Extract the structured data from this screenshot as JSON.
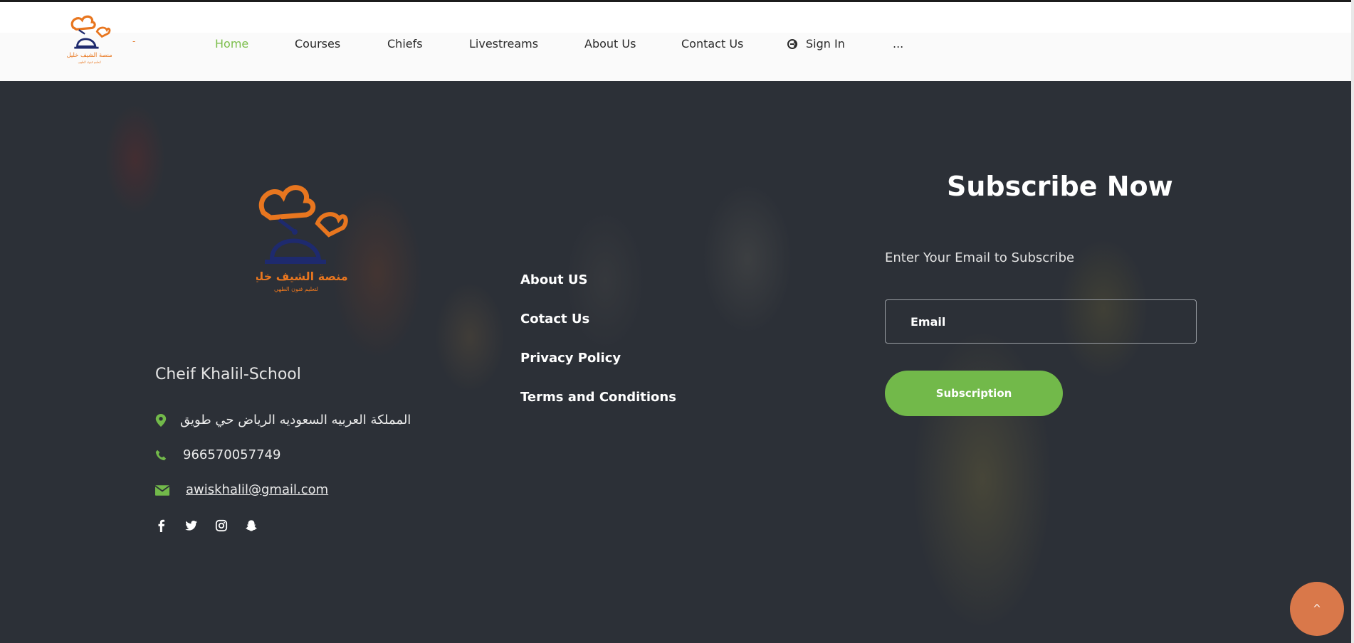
{
  "header": {
    "dash": "-",
    "nav": [
      {
        "label": "Home",
        "active": true
      },
      {
        "label": "Courses"
      },
      {
        "label": "Chiefs"
      },
      {
        "label": "Livestreams"
      },
      {
        "label": "About Us"
      },
      {
        "label": "Contact Us"
      },
      {
        "label": "Sign In"
      },
      {
        "label": "..."
      }
    ]
  },
  "footer": {
    "logo_text_ar": "منصة الشيف خليل",
    "logo_subtext_ar": "لتعليم فنون الطهي",
    "school_name": "Cheif Khalil-School",
    "address": "المملكة العربيه السعوديه الرياض حي طويق",
    "phone": "966570057749",
    "email": "awiskhalil@gmail.com",
    "social_icons": [
      "facebook-icon",
      "twitter-icon",
      "instagram-icon",
      "snapchat-icon"
    ],
    "links": [
      "About US",
      "Cotact Us",
      "Privacy Policy",
      "Terms and Conditions"
    ],
    "subscribe": {
      "title": "Subscribe Now",
      "label": "Enter Your Email to Subscribe",
      "placeholder": "Email",
      "button": "Subscription"
    },
    "scroll_top_glyph": "^"
  },
  "colors": {
    "accent_green": "#72b94a",
    "active_nav": "#7bbe4a",
    "logo_orange": "#e8761f",
    "logo_navy": "#1e2a6e",
    "scroll_top": "#d9784a",
    "footer_bg": "#2c3037"
  }
}
